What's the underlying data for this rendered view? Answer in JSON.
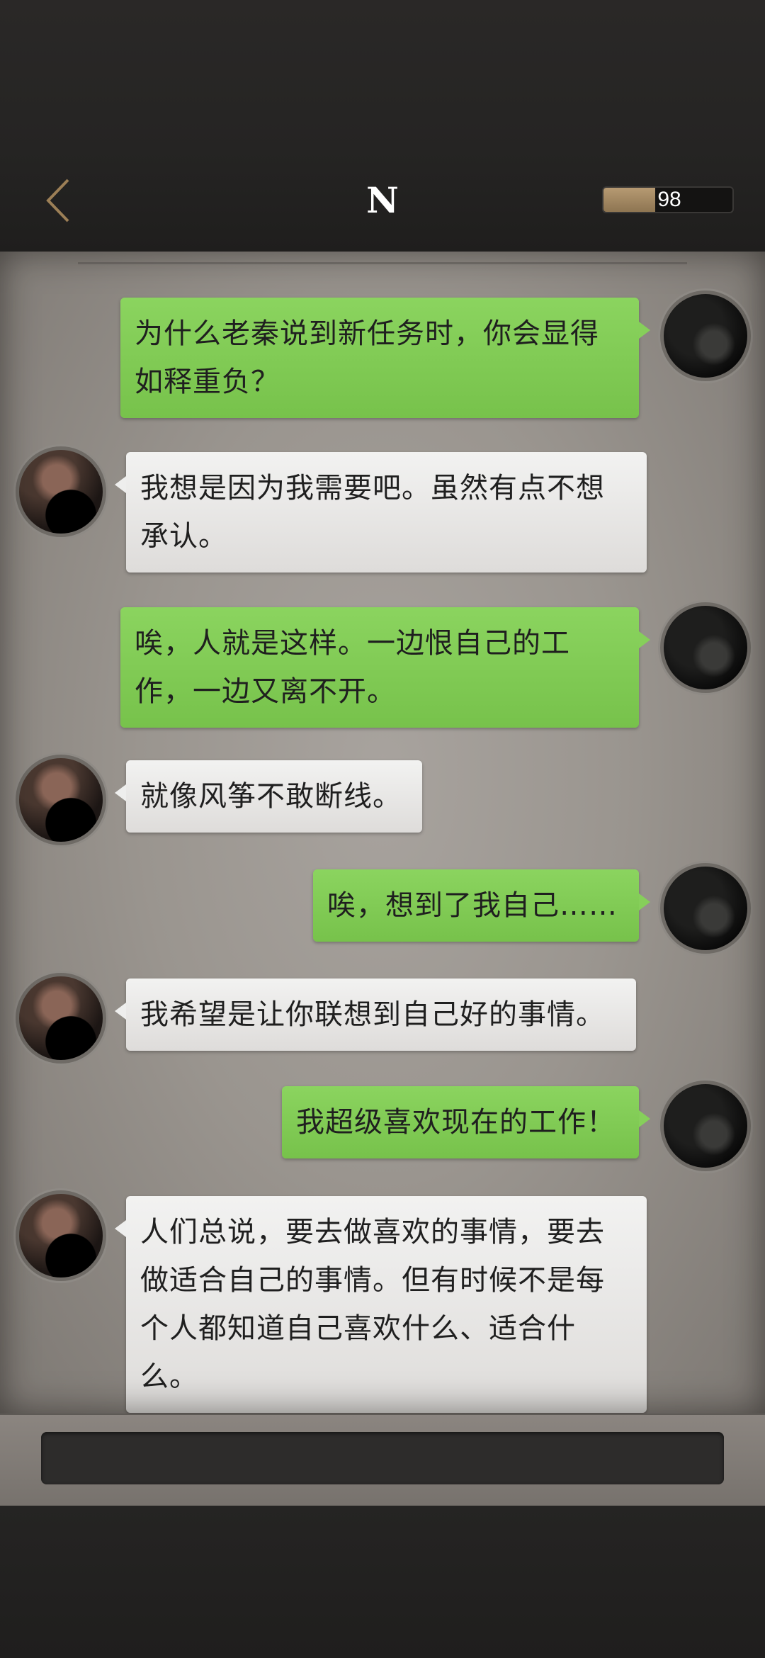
{
  "header": {
    "title": "N",
    "energy_value": "98",
    "energy_fraction": 0.4
  },
  "input": {
    "value": ""
  },
  "messages": [
    {
      "side": "out",
      "text": "为什么老秦说到新任务时，你会显得\n如释重负？"
    },
    {
      "side": "in",
      "text": "我想是因为我需要吧。虽然有点不想\n承认。"
    },
    {
      "side": "out",
      "text": "唉，人就是这样。一边恨自己的工\n作，一边又离不开。"
    },
    {
      "side": "in",
      "text": "就像风筝不敢断线。"
    },
    {
      "side": "out",
      "text": "唉，想到了我自己……"
    },
    {
      "side": "in",
      "text": "我希望是让你联想到自己好的事情。"
    },
    {
      "side": "out",
      "text": "我超级喜欢现在的工作！"
    },
    {
      "side": "in",
      "text": "人们总说，要去做喜欢的事情，要去\n做适合自己的事情。但有时候不是每\n个人都知道自己喜欢什么、适合什\n么。"
    }
  ],
  "colors": {
    "outgoing_bubble": "#80cb55",
    "incoming_bubble": "#e9e8e6",
    "energy_bar": "#a88b63",
    "back_chevron": "#9c7f56"
  }
}
